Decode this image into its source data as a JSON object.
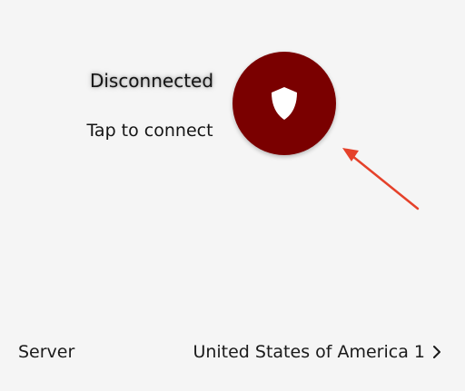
{
  "connection": {
    "status": "Disconnected",
    "hint": "Tap to connect",
    "button_icon": "shield-icon",
    "button_color": "#7a0000"
  },
  "annotation": {
    "arrow_color": "#e5412a"
  },
  "server": {
    "label": "Server",
    "value": "United States of America 1",
    "chevron_icon": "chevron-right-icon"
  }
}
